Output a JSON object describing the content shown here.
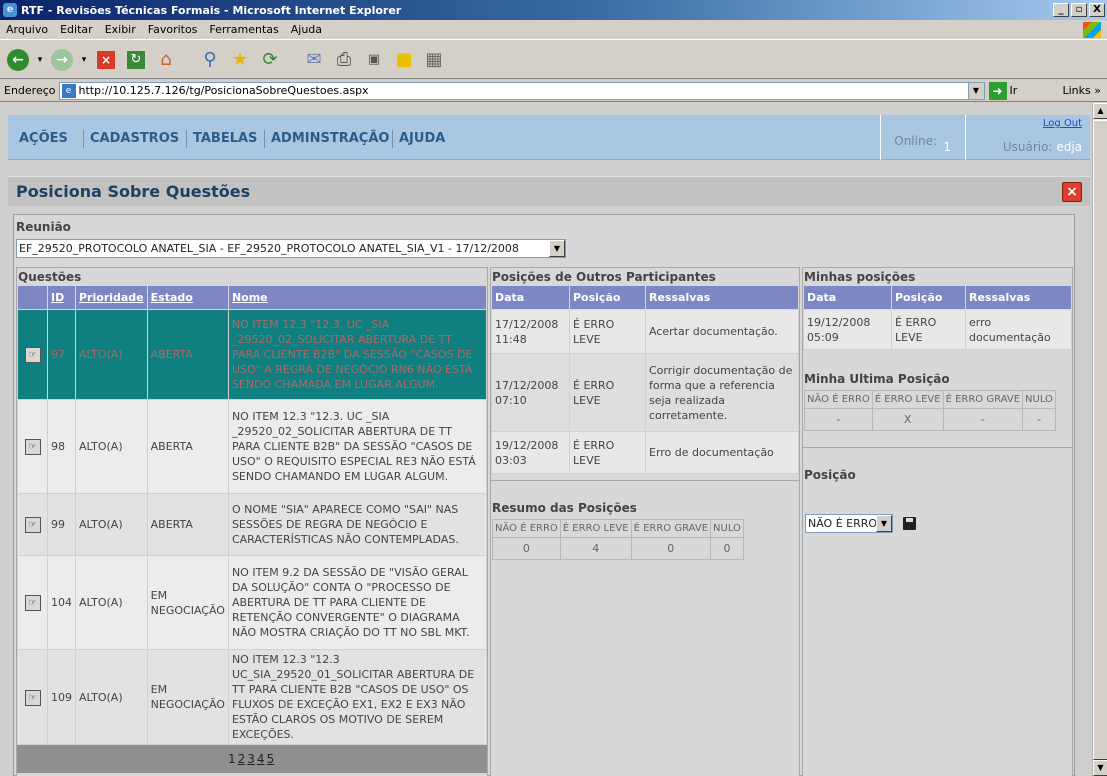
{
  "window": {
    "title": "RTF - Revisões Técnicas Formais - Microsoft Internet Explorer",
    "controls": [
      "_",
      "▫",
      "X"
    ]
  },
  "menu": [
    "Arquivo",
    "Editar",
    "Exibir",
    "Favoritos",
    "Ferramentas",
    "Ajuda"
  ],
  "address": {
    "label": "Endereço",
    "url": "http://10.125.7.126/tg/PosicionaSobreQuestoes.aspx",
    "go": "Ir",
    "links": "Links"
  },
  "nav": {
    "items": [
      "AÇÕES",
      "CADASTROS",
      "TABELAS",
      "ADMINSTRAÇÃO",
      "AJUDA"
    ],
    "online_label": "Online:",
    "online_count": "1",
    "logout": "Log Out",
    "user_label": "Usuário:",
    "user": "edja"
  },
  "page": {
    "title": "Posiciona Sobre Questões"
  },
  "reuniao": {
    "label": "Reunião",
    "selected": "EF_29520_PROTOCOLO ANATEL_SIA - EF_29520_PROTOCOLO ANATEL_SIA_V1 - 17/12/2008"
  },
  "questoes": {
    "title": "Questões",
    "headers": [
      "ID",
      "Prioridade",
      "Estado",
      "Nome"
    ],
    "rows": [
      {
        "id": "97",
        "prioridade": "ALTO(A)",
        "estado": "ABERTA",
        "nome": "NO ITEM 12.3 \"12.3. UC _SIA _29520_02_SOLICITAR ABERTURA DE TT PARA CLIENTE B2B\" DA SESSÃO \"CASOS DE USO\" A REGRA DE NEGÓCIO RN6 NÃO ESTÁ SENDO CHAMADA EM LUGAR ALGUM."
      },
      {
        "id": "98",
        "prioridade": "ALTO(A)",
        "estado": "ABERTA",
        "nome": "NO ITEM 12.3 \"12.3. UC _SIA _29520_02_SOLICITAR ABERTURA DE TT PARA CLIENTE B2B\" DA SESSÃO \"CASOS DE USO\" O REQUISITO ESPECIAL RE3 NÃO ESTÁ SENDO CHAMANDO EM LUGAR ALGUM."
      },
      {
        "id": "99",
        "prioridade": "ALTO(A)",
        "estado": "ABERTA",
        "nome": "O NOME \"SIA\" APARECE COMO \"SAI\" NAS SESSÕES DE REGRA DE NEGÓCIO E CARACTERÍSTICAS NÃO CONTEMPLADAS."
      },
      {
        "id": "104",
        "prioridade": "ALTO(A)",
        "estado": "EM NEGOCIAÇÃO",
        "nome": "NO ITEM 9.2 DA SESSÃO DE \"VISÃO GERAL DA SOLUÇÃO\" CONTA O \"PROCESSO DE ABERTURA DE TT PARA CLIENTE DE RETENÇÃO CONVERGENTE\" O DIAGRAMA NÃO MOSTRA CRIAÇÃO DO TT NO SBL MKT."
      },
      {
        "id": "109",
        "prioridade": "ALTO(A)",
        "estado": "EM NEGOCIAÇÃO",
        "nome": "NO ITEM 12.3 \"12.3 UC_SIA_29520_01_SOLICITAR ABERTURA DE TT PARA CLIENTE B2B \"CASOS DE USO\" OS FLUXOS DE EXCEÇÃO EX1, EX2 E EX3 NÃO ESTÃO CLAROS OS MOTIVO DE SEREM EXCEÇÕES."
      }
    ],
    "pages": [
      "1",
      "2",
      "3",
      "4",
      "5"
    ]
  },
  "outros": {
    "title": "Posições de Outros Participantes",
    "headers": [
      "Data",
      "Posição",
      "Ressalvas"
    ],
    "rows": [
      {
        "data": "17/12/2008 11:48",
        "posicao": "É ERRO LEVE",
        "ressalvas": "Acertar documentação."
      },
      {
        "data": "17/12/2008 07:10",
        "posicao": "É ERRO LEVE",
        "ressalvas": "Corrigir documentação de forma que a referencia seja realizada corretamente."
      },
      {
        "data": "19/12/2008 03:03",
        "posicao": "É ERRO LEVE",
        "ressalvas": "Erro de documentação"
      }
    ]
  },
  "resumo": {
    "title": "Resumo das Posições",
    "headers": [
      "NÃO É ERRO",
      "É ERRO LEVE",
      "É ERRO GRAVE",
      "NULO"
    ],
    "values": [
      "0",
      "4",
      "0",
      "0"
    ]
  },
  "minhas": {
    "title": "Minhas posições",
    "headers": [
      "Data",
      "Posição",
      "Ressalvas"
    ],
    "rows": [
      {
        "data": "19/12/2008 05:09",
        "posicao": "É ERRO LEVE",
        "ressalvas": "erro documentação"
      }
    ]
  },
  "ultima": {
    "title": "Minha Ultima Posição",
    "headers": [
      "NÃO É ERRO",
      "É ERRO LEVE",
      "É ERRO GRAVE",
      "NULO"
    ],
    "values": [
      "-",
      "X",
      "-",
      "-"
    ]
  },
  "posicao": {
    "label": "Posição",
    "selected": "NÃO É ERRO"
  }
}
